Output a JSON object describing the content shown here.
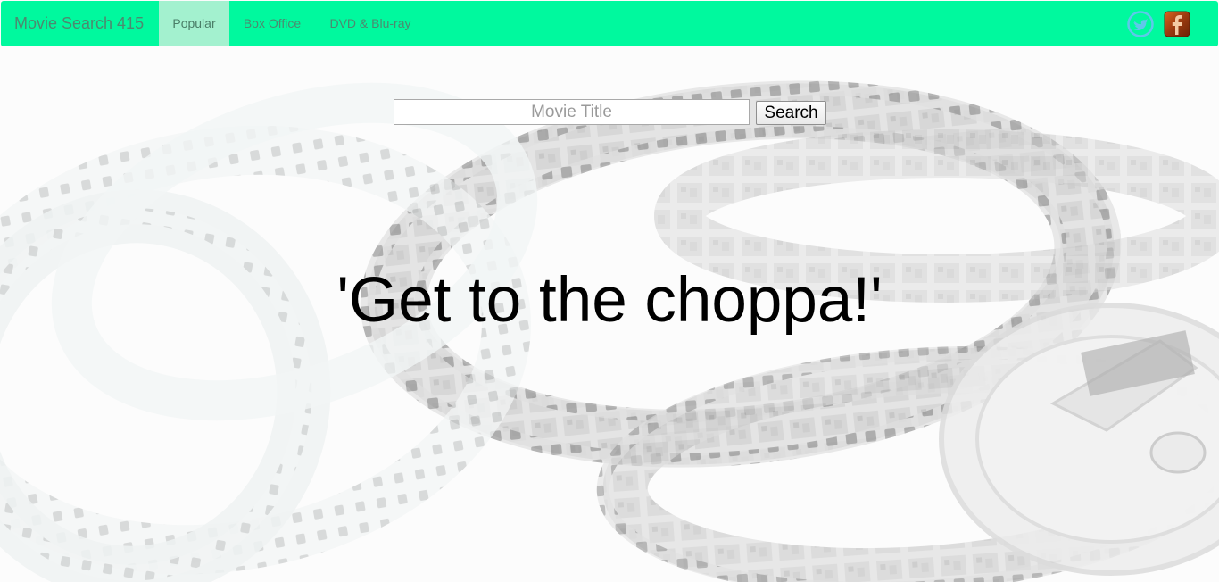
{
  "navbar": {
    "brand": "Movie Search 415",
    "items": [
      {
        "label": "Popular",
        "active": true
      },
      {
        "label": "Box Office",
        "active": false
      },
      {
        "label": "DVD & Blu-ray",
        "active": false
      }
    ],
    "social": [
      {
        "name": "twitter-icon",
        "color": "#5fc7ea"
      },
      {
        "name": "facebook-icon",
        "color": "#b7410e"
      }
    ],
    "accent": "#00f99e"
  },
  "search": {
    "placeholder": "Movie Title",
    "value": "",
    "button_label": "Search"
  },
  "hero": {
    "quote": "'Get to the choppa!'"
  }
}
